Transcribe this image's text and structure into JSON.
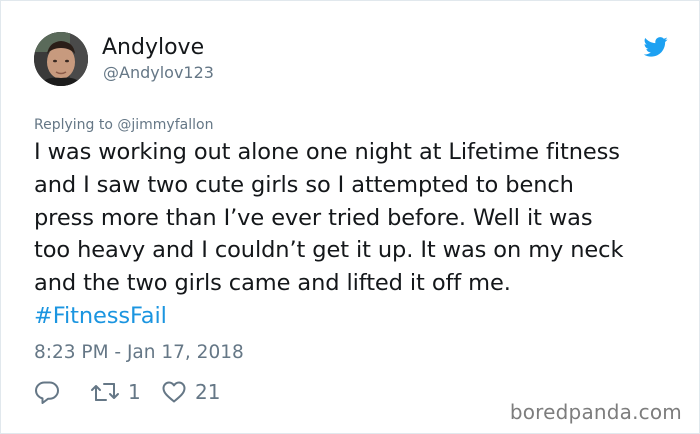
{
  "user": {
    "display_name": "Andylove",
    "handle": "@Andylov123",
    "avatar": "avatar-photo"
  },
  "header": {
    "brand_icon": "twitter-bird-icon",
    "brand_color": "#1da1f2"
  },
  "tweet": {
    "replying_to": "Replying to @jimmyfallon",
    "lines": [
      "I was working out alone one night at Lifetime fitness",
      "and I saw two cute girls so I attempted to bench",
      "press more than I’ve ever tried before. Well it was",
      "too heavy and I couldn’t get it up. It was on my neck",
      "and the two girls came and lifted it off me."
    ],
    "hashtag": "#FitnessFail",
    "hashtag_color": "#1b95e0",
    "timestamp": "8:23 PM - Jan 17, 2018"
  },
  "actions": {
    "reply": {
      "icon": "reply-bubble-icon",
      "count": ""
    },
    "retweet": {
      "icon": "retweet-icon",
      "count": "1"
    },
    "like": {
      "icon": "heart-icon",
      "count": "21"
    }
  },
  "watermark": "boredpanda.com"
}
